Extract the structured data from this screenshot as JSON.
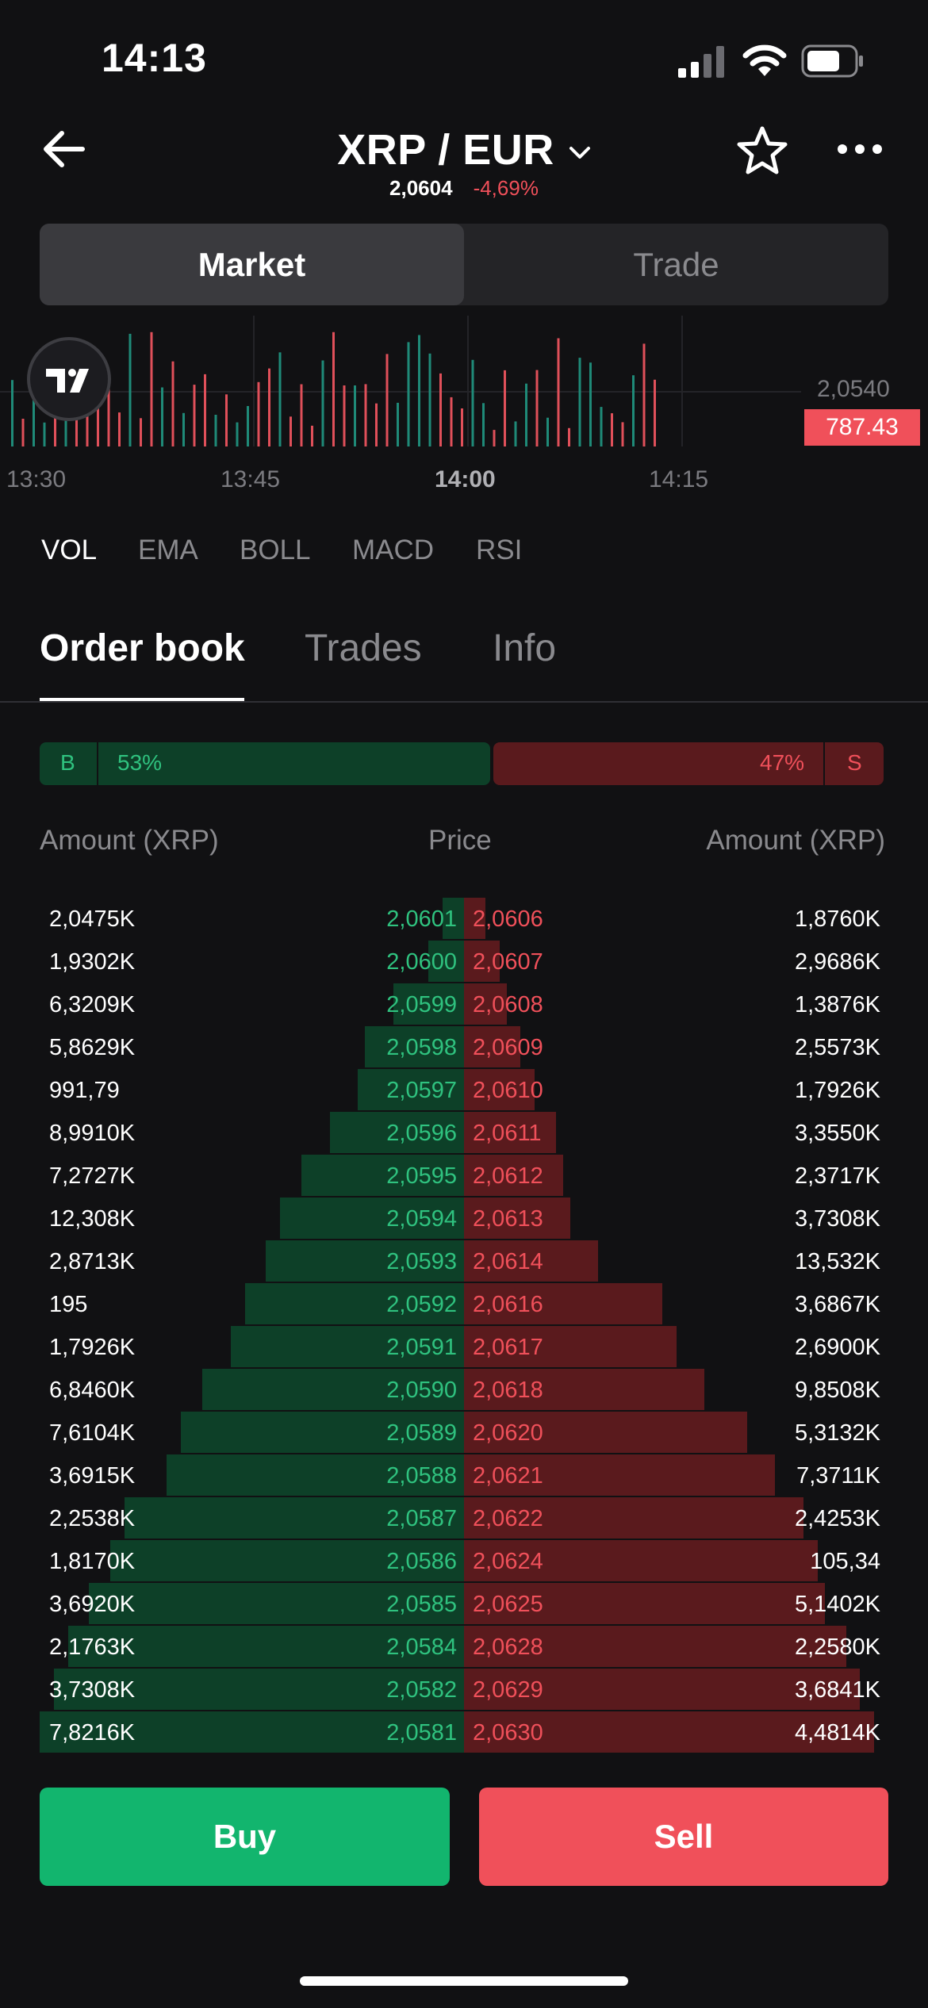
{
  "status_bar": {
    "time": "14:13"
  },
  "header": {
    "pair": "XRP / EUR",
    "last_price": "2,0604",
    "change": "-4,69%"
  },
  "segments": [
    {
      "label": "Market",
      "active": true
    },
    {
      "label": "Trade",
      "active": false
    }
  ],
  "chart": {
    "price_axis_label": "2,0540",
    "volume_tag": "787.43",
    "time_labels": [
      "13:30",
      "13:45",
      "14:00",
      "14:15"
    ],
    "colors": {
      "up": "#1f8a78",
      "down": "#e0505a"
    }
  },
  "indicators": [
    {
      "label": "VOL",
      "active": true
    },
    {
      "label": "EMA",
      "active": false
    },
    {
      "label": "BOLL",
      "active": false
    },
    {
      "label": "MACD",
      "active": false
    },
    {
      "label": "RSI",
      "active": false
    }
  ],
  "tabs": [
    {
      "label": "Order book",
      "active": true
    },
    {
      "label": "Trades",
      "active": false
    },
    {
      "label": "Info",
      "active": false
    }
  ],
  "ratio": {
    "buy_letter": "B",
    "buy_pct": "53%",
    "sell_pct": "47%",
    "sell_letter": "S",
    "buy_share": 0.53
  },
  "columns": {
    "left": "Amount (XRP)",
    "middle": "Price",
    "right": "Amount (XRP)"
  },
  "order_book": [
    {
      "bid_amount": "2,0475K",
      "bid_price": "2,0601",
      "ask_price": "2,0606",
      "ask_amount": "1,8760K",
      "bid_depth": 0.03,
      "ask_depth": 0.03
    },
    {
      "bid_amount": "1,9302K",
      "bid_price": "2,0600",
      "ask_price": "2,0607",
      "ask_amount": "2,9686K",
      "bid_depth": 0.05,
      "ask_depth": 0.05
    },
    {
      "bid_amount": "6,3209K",
      "bid_price": "2,0599",
      "ask_price": "2,0608",
      "ask_amount": "1,3876K",
      "bid_depth": 0.1,
      "ask_depth": 0.06
    },
    {
      "bid_amount": "5,8629K",
      "bid_price": "2,0598",
      "ask_price": "2,0609",
      "ask_amount": "2,5573K",
      "bid_depth": 0.14,
      "ask_depth": 0.08
    },
    {
      "bid_amount": "991,79",
      "bid_price": "2,0597",
      "ask_price": "2,0610",
      "ask_amount": "1,7926K",
      "bid_depth": 0.15,
      "ask_depth": 0.1
    },
    {
      "bid_amount": "8,9910K",
      "bid_price": "2,0596",
      "ask_price": "2,0611",
      "ask_amount": "3,3550K",
      "bid_depth": 0.19,
      "ask_depth": 0.13
    },
    {
      "bid_amount": "7,2727K",
      "bid_price": "2,0595",
      "ask_price": "2,0612",
      "ask_amount": "2,3717K",
      "bid_depth": 0.23,
      "ask_depth": 0.14
    },
    {
      "bid_amount": "12,308K",
      "bid_price": "2,0594",
      "ask_price": "2,0613",
      "ask_amount": "3,7308K",
      "bid_depth": 0.26,
      "ask_depth": 0.15
    },
    {
      "bid_amount": "2,8713K",
      "bid_price": "2,0593",
      "ask_price": "2,0614",
      "ask_amount": "13,532K",
      "bid_depth": 0.28,
      "ask_depth": 0.19
    },
    {
      "bid_amount": "195",
      "bid_price": "2,0592",
      "ask_price": "2,0616",
      "ask_amount": "3,6867K",
      "bid_depth": 0.31,
      "ask_depth": 0.28
    },
    {
      "bid_amount": "1,7926K",
      "bid_price": "2,0591",
      "ask_price": "2,0617",
      "ask_amount": "2,6900K",
      "bid_depth": 0.33,
      "ask_depth": 0.3
    },
    {
      "bid_amount": "6,8460K",
      "bid_price": "2,0590",
      "ask_price": "2,0618",
      "ask_amount": "9,8508K",
      "bid_depth": 0.37,
      "ask_depth": 0.34
    },
    {
      "bid_amount": "7,6104K",
      "bid_price": "2,0589",
      "ask_price": "2,0620",
      "ask_amount": "5,3132K",
      "bid_depth": 0.4,
      "ask_depth": 0.4
    },
    {
      "bid_amount": "3,6915K",
      "bid_price": "2,0588",
      "ask_price": "2,0621",
      "ask_amount": "7,3711K",
      "bid_depth": 0.42,
      "ask_depth": 0.44
    },
    {
      "bid_amount": "2,2538K",
      "bid_price": "2,0587",
      "ask_price": "2,0622",
      "ask_amount": "2,4253K",
      "bid_depth": 0.48,
      "ask_depth": 0.48
    },
    {
      "bid_amount": "1,8170K",
      "bid_price": "2,0586",
      "ask_price": "2,0624",
      "ask_amount": "105,34",
      "bid_depth": 0.5,
      "ask_depth": 0.5
    },
    {
      "bid_amount": "3,6920K",
      "bid_price": "2,0585",
      "ask_price": "2,0625",
      "ask_amount": "5,1402K",
      "bid_depth": 0.53,
      "ask_depth": 0.51
    },
    {
      "bid_amount": "2,1763K",
      "bid_price": "2,0584",
      "ask_price": "2,0628",
      "ask_amount": "2,2580K",
      "bid_depth": 0.56,
      "ask_depth": 0.54
    },
    {
      "bid_amount": "3,7308K",
      "bid_price": "2,0582",
      "ask_price": "2,0629",
      "ask_amount": "3,6841K",
      "bid_depth": 0.58,
      "ask_depth": 0.56
    },
    {
      "bid_amount": "7,8216K",
      "bid_price": "2,0581",
      "ask_price": "2,0630",
      "ask_amount": "4,4814K",
      "bid_depth": 0.6,
      "ask_depth": 0.58
    }
  ],
  "actions": {
    "buy": "Buy",
    "sell": "Sell"
  }
}
